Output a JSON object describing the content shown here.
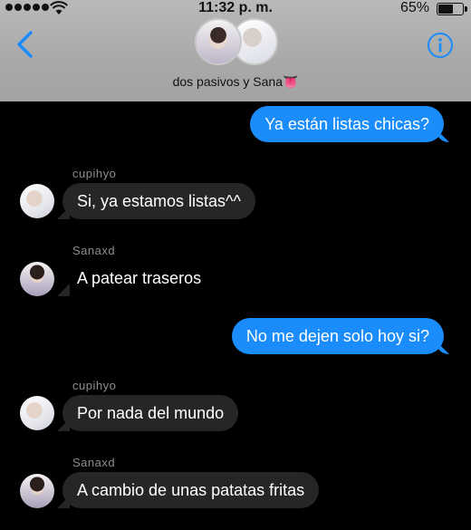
{
  "status_bar": {
    "time": "11:32 p. m.",
    "battery_percent": "65%",
    "battery_level": 0.65,
    "signal_dots": 5,
    "wifi_icon": "wifi-icon",
    "battery_icon": "battery-icon"
  },
  "header": {
    "title": "dos pasivos y Sana👅",
    "back_icon": "chevron-left-icon",
    "info_icon": "info-icon",
    "accent_color": "#1a8cfb"
  },
  "messages": [
    {
      "type": "sent",
      "text": "Ya están listas chicas?"
    },
    {
      "type": "received",
      "sender": "cupihyo",
      "text": "Si, ya estamos listas^^"
    },
    {
      "type": "received",
      "sender": "Sanaxd",
      "text": "A patear traseros"
    },
    {
      "type": "sent",
      "text": "No me dejen solo hoy si?"
    },
    {
      "type": "received",
      "sender": "cupihyo",
      "text": "Por nada del mundo"
    },
    {
      "type": "received",
      "sender": "Sanaxd",
      "text": "A cambio de unas patatas fritas"
    }
  ],
  "colors": {
    "sent_bubble": "#1a8cfb",
    "received_bubble": "#262628",
    "background": "#000000",
    "header_bg": "#a9a9a9"
  }
}
